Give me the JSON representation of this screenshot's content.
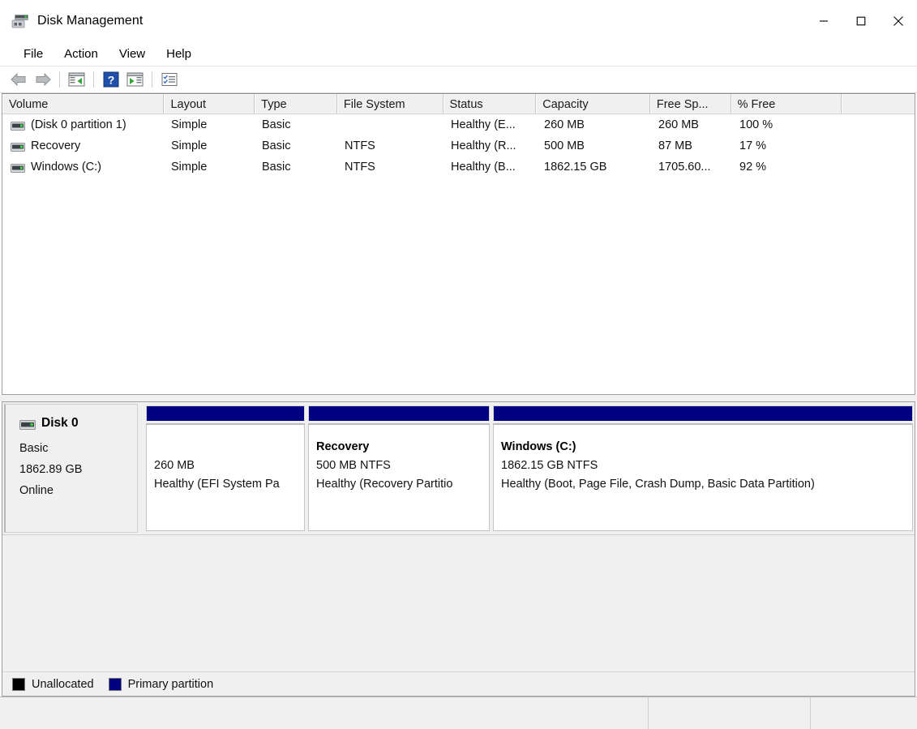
{
  "window": {
    "title": "Disk Management",
    "icon": "disk-management-icon",
    "controls": {
      "minimize": "—",
      "maximize": "☐",
      "close": "✕"
    }
  },
  "menubar": {
    "items": [
      {
        "label": "File"
      },
      {
        "label": "Action"
      },
      {
        "label": "View"
      },
      {
        "label": "Help"
      }
    ]
  },
  "toolbar": {
    "buttons": [
      {
        "name": "back-arrow-icon",
        "title": "Back"
      },
      {
        "name": "forward-arrow-icon",
        "title": "Forward"
      },
      {
        "name": "show-hide-console-tree-icon",
        "title": "Show/Hide Console Tree"
      },
      {
        "name": "help-icon",
        "title": "Help"
      },
      {
        "name": "show-hide-action-pane-icon",
        "title": "Show/Hide Action Pane"
      },
      {
        "name": "properties-icon",
        "title": "Properties"
      }
    ]
  },
  "volume_list": {
    "columns": [
      {
        "key": "volume",
        "label": "Volume"
      },
      {
        "key": "layout",
        "label": "Layout"
      },
      {
        "key": "type",
        "label": "Type"
      },
      {
        "key": "filesystem",
        "label": "File System"
      },
      {
        "key": "status",
        "label": "Status"
      },
      {
        "key": "capacity",
        "label": "Capacity"
      },
      {
        "key": "free",
        "label": "Free Sp..."
      },
      {
        "key": "pfree",
        "label": "% Free"
      },
      {
        "key": "blank",
        "label": ""
      }
    ],
    "rows": [
      {
        "volume": "(Disk 0 partition 1)",
        "layout": "Simple",
        "type": "Basic",
        "filesystem": "",
        "status": "Healthy (E...",
        "capacity": "260 MB",
        "free": "260 MB",
        "pfree": "100 %"
      },
      {
        "volume": "Recovery",
        "layout": "Simple",
        "type": "Basic",
        "filesystem": "NTFS",
        "status": "Healthy (R...",
        "capacity": "500 MB",
        "free": "87 MB",
        "pfree": "17 %"
      },
      {
        "volume": "Windows (C:)",
        "layout": "Simple",
        "type": "Basic",
        "filesystem": "NTFS",
        "status": "Healthy (B...",
        "capacity": "1862.15 GB",
        "free": "1705.60...",
        "pfree": "92 %"
      }
    ]
  },
  "graphic_view": {
    "disk": {
      "name": "Disk 0",
      "type": "Basic",
      "size": "1862.89 GB",
      "status": "Online"
    },
    "partitions": [
      {
        "name": "",
        "size_fs": "260 MB",
        "status": "Healthy (EFI System Pa",
        "bar_color": "#000080"
      },
      {
        "name": "Recovery",
        "size_fs": "500 MB NTFS",
        "status": "Healthy (Recovery Partitio",
        "bar_color": "#000080"
      },
      {
        "name": "Windows  (C:)",
        "size_fs": "1862.15 GB NTFS",
        "status": "Healthy (Boot, Page File, Crash Dump, Basic Data Partition)",
        "bar_color": "#000080"
      }
    ]
  },
  "legend": {
    "items": [
      {
        "label": "Unallocated",
        "color": "#000000"
      },
      {
        "label": "Primary partition",
        "color": "#000080"
      }
    ]
  },
  "statusbar": {
    "segments": [
      "",
      "",
      ""
    ]
  }
}
